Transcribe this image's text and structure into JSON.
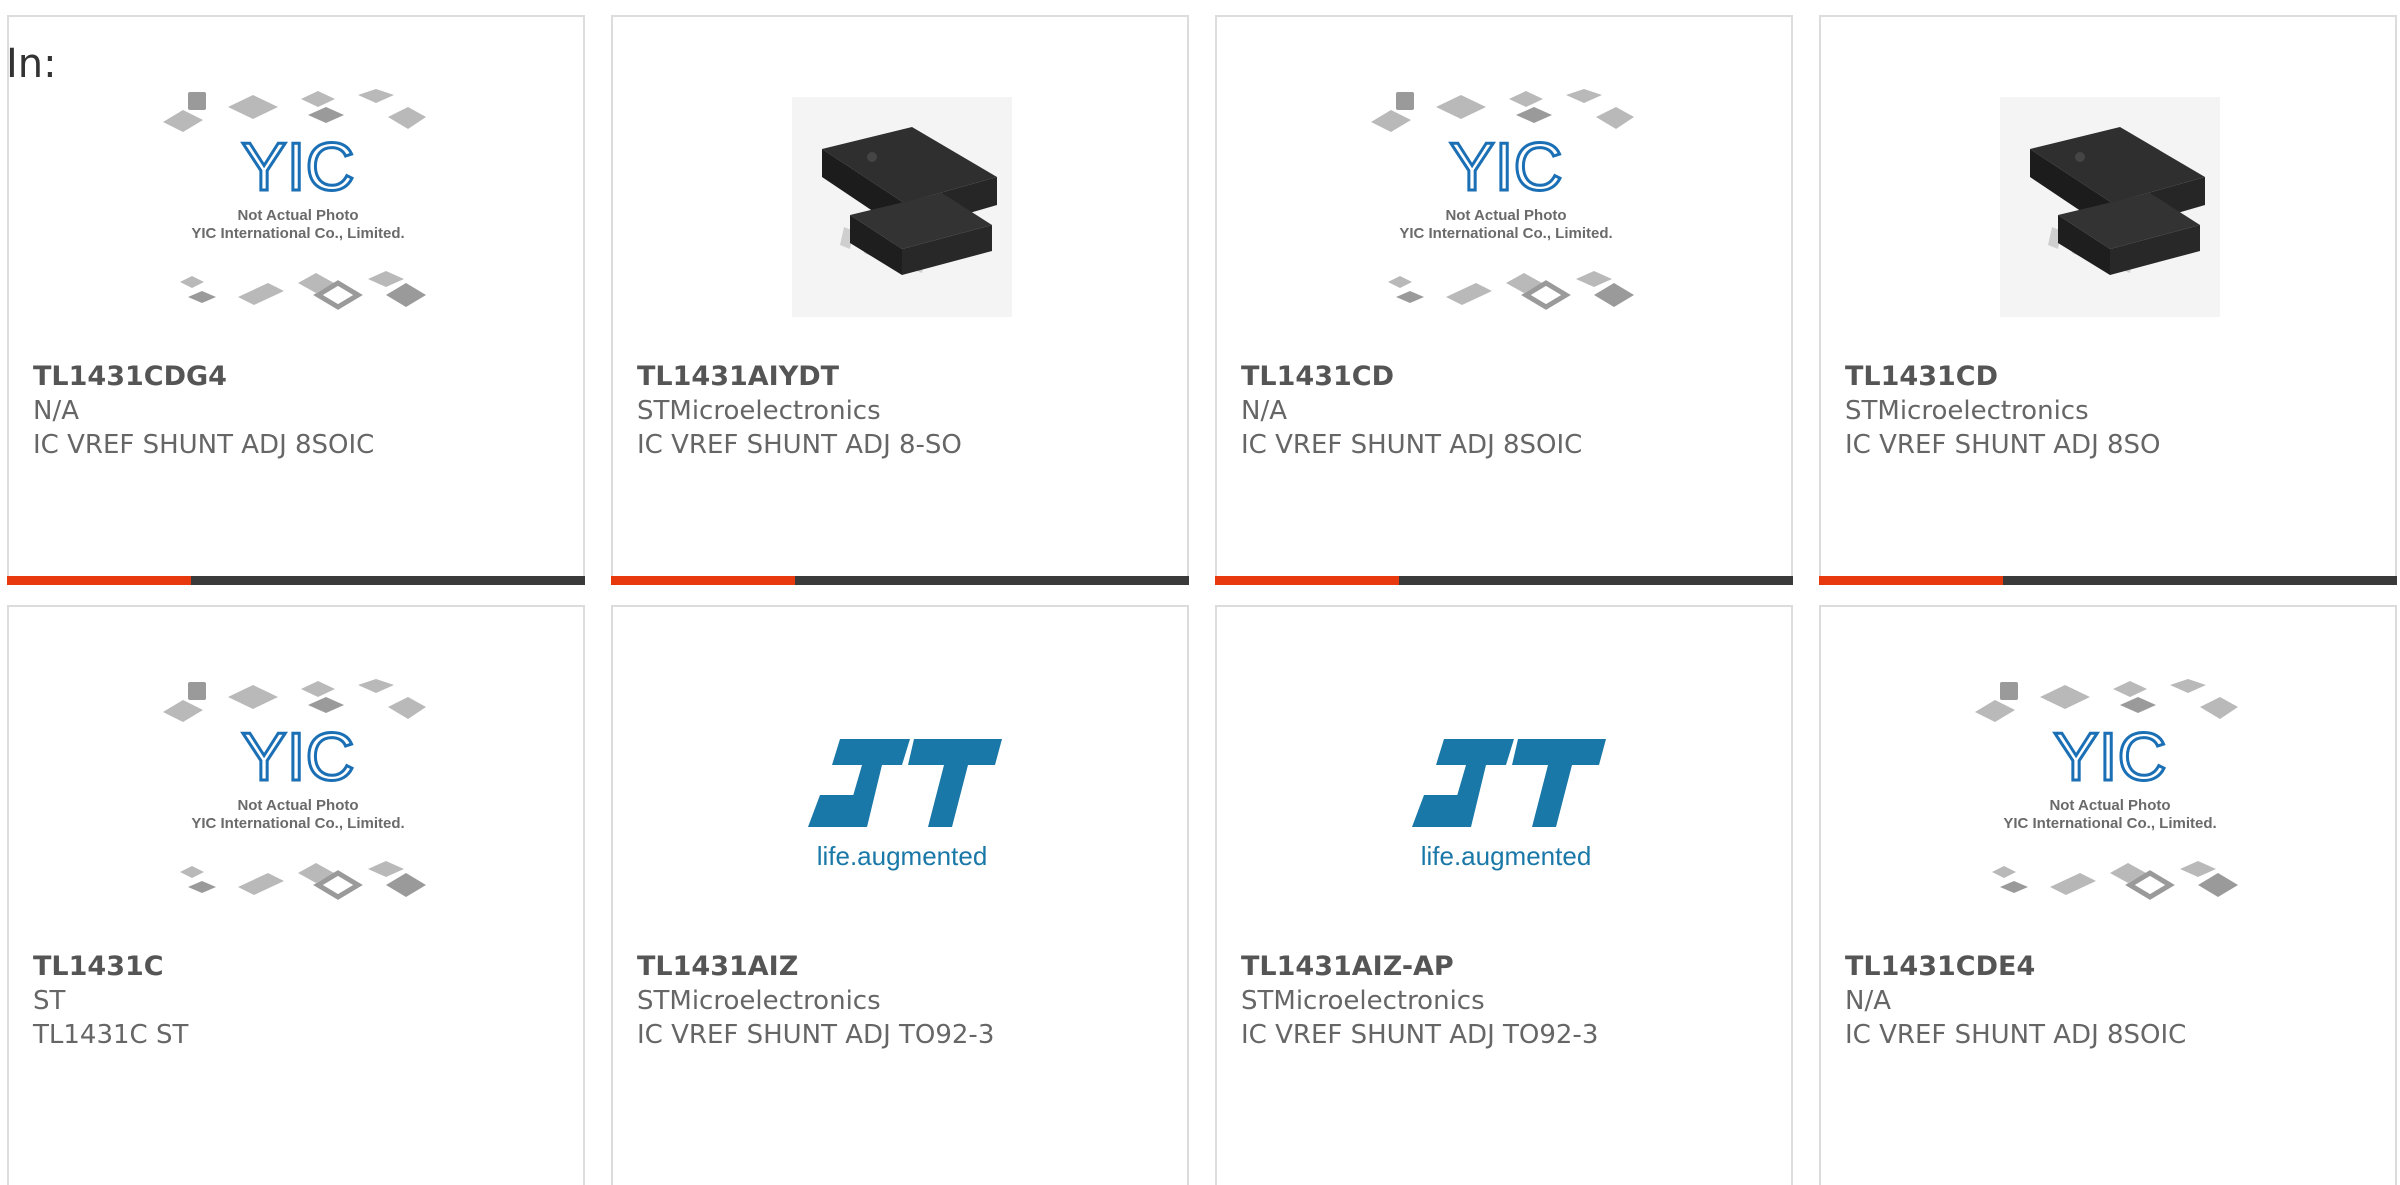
{
  "filter_label": "In:",
  "colors": {
    "accent": "#e8380d",
    "bar": "#3a3a3a",
    "yic_blue": "#1a6fb5",
    "st_blue": "#1a78a8"
  },
  "products": [
    {
      "part": "TL1431CDG4",
      "manufacturer": "N/A",
      "description": "IC VREF SHUNT ADJ 8SOIC",
      "image": "yic-placeholder"
    },
    {
      "part": "TL1431AIYDT",
      "manufacturer": "STMicroelectronics",
      "description": "IC VREF SHUNT ADJ 8-SO",
      "image": "soic-8-chip"
    },
    {
      "part": "TL1431CD",
      "manufacturer": "N/A",
      "description": "IC VREF SHUNT ADJ 8SOIC",
      "image": "yic-placeholder"
    },
    {
      "part": "TL1431CD",
      "manufacturer": "STMicroelectronics",
      "description": "IC VREF SHUNT ADJ 8SO",
      "image": "soic-8-chip"
    },
    {
      "part": "TL1431C",
      "manufacturer": "ST",
      "description": "TL1431C ST",
      "image": "yic-placeholder"
    },
    {
      "part": "TL1431AIZ",
      "manufacturer": "STMicroelectronics",
      "description": "IC VREF SHUNT ADJ TO92-3",
      "image": "st-logo"
    },
    {
      "part": "TL1431AIZ-AP",
      "manufacturer": "STMicroelectronics",
      "description": "IC VREF SHUNT ADJ TO92-3",
      "image": "st-logo"
    },
    {
      "part": "TL1431CDE4",
      "manufacturer": "N/A",
      "description": "IC VREF SHUNT ADJ 8SOIC",
      "image": "yic-placeholder"
    }
  ],
  "placeholder": {
    "line1": "Not Actual Photo",
    "line2": "YIC International Co., Limited.",
    "brand": "YIC"
  },
  "st_logo": {
    "tagline_a": "life.",
    "tagline_b": "augmented"
  }
}
